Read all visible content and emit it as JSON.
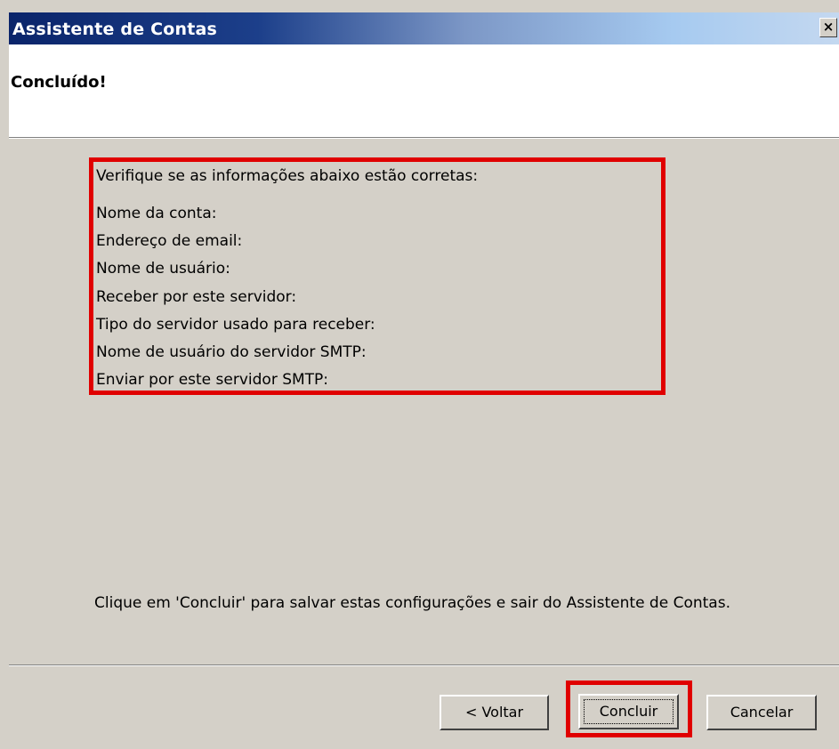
{
  "window": {
    "title": "Assistente de Contas",
    "close_glyph": "×"
  },
  "header": {
    "heading": "Concluído!"
  },
  "summary": {
    "intro": "Verifique se as informações abaixo estão corretas:",
    "fields": [
      "Nome da conta:",
      "Endereço de email:",
      "Nome de usuário:",
      "Receber por este servidor:",
      "Tipo do servidor usado para receber:",
      "Nome de usuário do servidor SMTP:",
      "Enviar por este servidor SMTP:"
    ]
  },
  "note": "Clique em 'Concluir' para salvar estas configurações e sair do Assistente de Contas.",
  "buttons": {
    "back": "< Voltar",
    "finish": "Concluir",
    "cancel": "Cancelar"
  },
  "colors": {
    "titlebar_start": "#0a246a",
    "dialog_bg": "#d4d0c8",
    "highlight": "#e00000"
  }
}
